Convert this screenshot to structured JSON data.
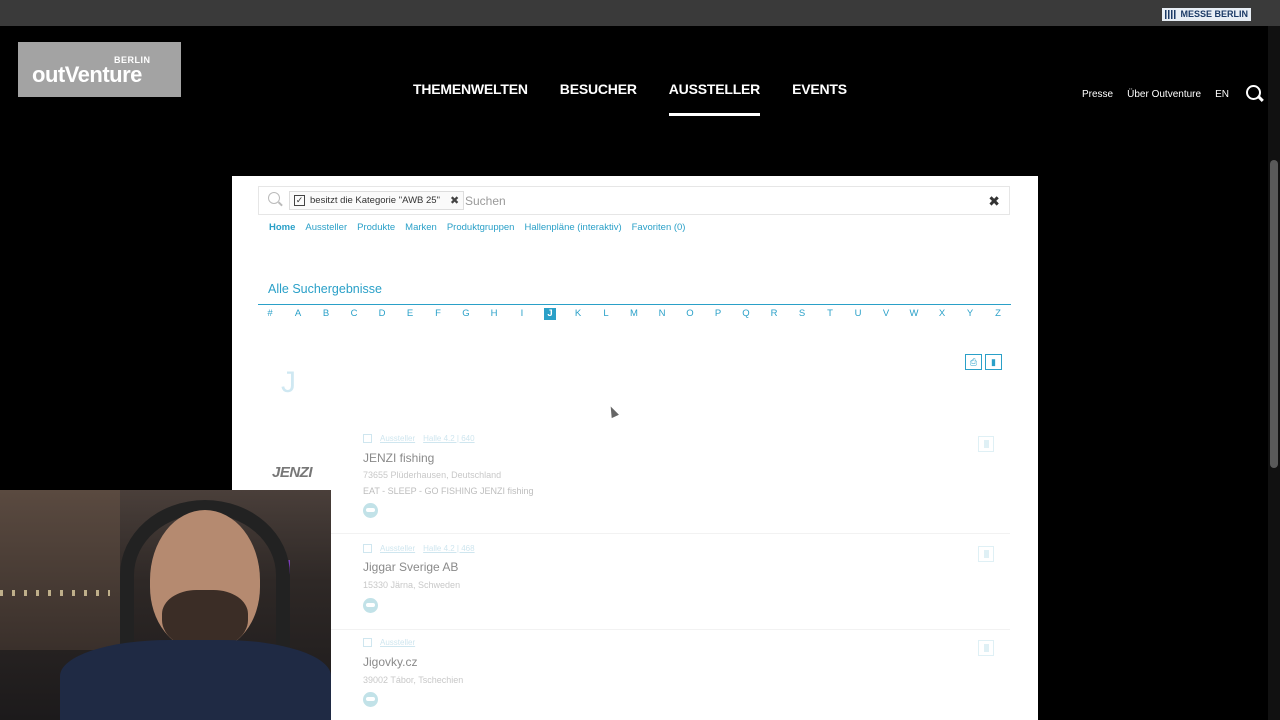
{
  "site_header": {
    "messe_badge": "MESSE BERLIN",
    "logo": {
      "line1": "BERLIN",
      "line2": "outVenture"
    },
    "main_nav": [
      {
        "label": "THEMENWELTEN",
        "active": false
      },
      {
        "label": "BESUCHER",
        "active": false
      },
      {
        "label": "AUSSTELLER",
        "active": true
      },
      {
        "label": "EVENTS",
        "active": false
      }
    ],
    "meta_nav": [
      "Presse",
      "Über Outventure",
      "EN"
    ]
  },
  "search": {
    "filter_chip": "besitzt die Kategorie \"AWB 25\"",
    "placeholder": "Suchen"
  },
  "sub_nav": [
    {
      "label": "Home",
      "active": true
    },
    {
      "label": "Aussteller",
      "active": false
    },
    {
      "label": "Produkte",
      "active": false
    },
    {
      "label": "Marken",
      "active": false
    },
    {
      "label": "Produktgruppen",
      "active": false
    },
    {
      "label": "Hallenpläne (interaktiv)",
      "active": false
    },
    {
      "label": "Favoriten (0)",
      "active": false
    }
  ],
  "results": {
    "title": "Alle Suchergebnisse",
    "alphabet": [
      "#",
      "A",
      "B",
      "C",
      "D",
      "E",
      "F",
      "G",
      "H",
      "I",
      "J",
      "K",
      "L",
      "M",
      "N",
      "O",
      "P",
      "Q",
      "R",
      "S",
      "T",
      "U",
      "V",
      "W",
      "X",
      "Y",
      "Z"
    ],
    "current_letter": "J",
    "section_letter": "J",
    "entries": [
      {
        "type": "Aussteller",
        "hall": "Halle 4.2 | 640",
        "name": "JENZI fishing",
        "location": "73655 Plüderhausen, Deutschland",
        "description": "EAT - SLEEP - GO FISHING JENZI fishing",
        "logo_text": "JENZI"
      },
      {
        "type": "Aussteller",
        "hall": "Halle 4.2 | 468",
        "name": "Jiggar Sverige AB",
        "location": "15330 Järna, Schweden",
        "description": "",
        "logo_text": ""
      },
      {
        "type": "Aussteller",
        "hall": "",
        "name": "Jigovky.cz",
        "location": "39002 Tábor, Tschechien",
        "description": "",
        "logo_text": ""
      }
    ]
  }
}
